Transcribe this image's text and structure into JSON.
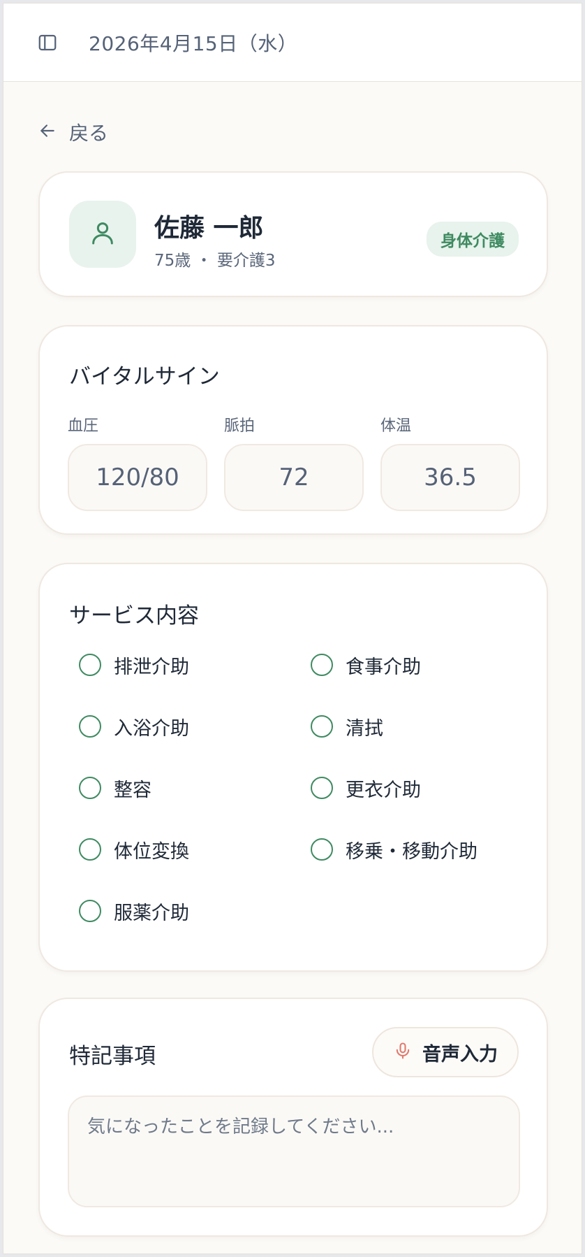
{
  "header": {
    "date": "2026年4月15日（水）"
  },
  "nav": {
    "back_label": "戻る"
  },
  "profile": {
    "name": "佐藤 一郎",
    "meta": "75歳 ・ 要介護3",
    "badge": "身体介護"
  },
  "vitals": {
    "title": "バイタルサイン",
    "items": [
      {
        "label": "血圧",
        "value": "120/80"
      },
      {
        "label": "脈拍",
        "value": "72"
      },
      {
        "label": "体温",
        "value": "36.5"
      }
    ]
  },
  "services": {
    "title": "サービス内容",
    "items": [
      {
        "label": "排泄介助"
      },
      {
        "label": "食事介助"
      },
      {
        "label": "入浴介助"
      },
      {
        "label": "清拭"
      },
      {
        "label": "整容"
      },
      {
        "label": "更衣介助"
      },
      {
        "label": "体位変換"
      },
      {
        "label": "移乗・移動介助"
      },
      {
        "label": "服薬介助"
      }
    ]
  },
  "notes": {
    "title": "特記事項",
    "voice_label": "音声入力",
    "placeholder": "気になったことを記録してください...",
    "value": ""
  },
  "colors": {
    "accent": "#3e8a61",
    "mic": "#e07a6e",
    "background": "#fbfaf7"
  },
  "icons": {
    "sidebar": "sidebar-toggle-icon",
    "back": "arrow-left-icon",
    "avatar": "user-icon",
    "voice": "microphone-icon"
  }
}
